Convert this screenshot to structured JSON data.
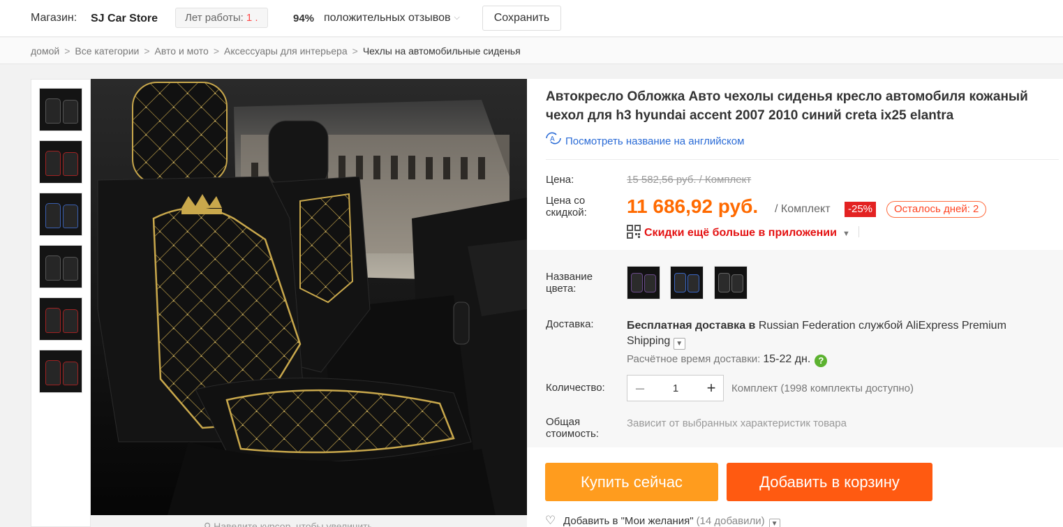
{
  "store": {
    "label": "Магазин:",
    "name": "SJ Car Store",
    "years_label": "Лет работы:",
    "years_value": "1 .",
    "feedback_percent": "94%",
    "feedback_text": "положительных отзывов",
    "save_label": "Сохранить"
  },
  "breadcrumb": {
    "items": [
      "домой",
      "Все категории",
      "Авто и мото",
      "Аксессуары для интерьера"
    ],
    "current": "Чехлы на автомобильные сиденья",
    "separator": ">"
  },
  "gallery": {
    "thumb_count": 6,
    "zoom_hint": "Наведите курсор, чтобы увеличить"
  },
  "product": {
    "title": "Автокресло Обложка Авто чехолы сиденья кресло автомобиля кожаный чехол для h3 hyundai accent 2007 2010 синий creta ix25 elantra",
    "translate_link": "Посмотреть название на английском",
    "price_label": "Цена:",
    "old_price": "15 582,56 руб. / Комплект",
    "discount_price_label": "Цена со скидкой:",
    "new_price": "11 686,92 руб.",
    "unit": "/ Комплект",
    "discount_badge": "-25%",
    "days_left": "Осталось дней: 2",
    "app_discount": "Скидки ещё больше в приложении",
    "color_label": "Название цвета:",
    "shipping_label": "Доставка:",
    "shipping_bold": "Бесплатная доставка в",
    "shipping_rest": "Russian Federation службой AliExpress Premium Shipping",
    "eta_label": "Расчётное время доставки:",
    "eta_value": "15-22 дн.",
    "qty_label": "Количество:",
    "qty_value": "1",
    "qty_minus": "–",
    "qty_plus": "+",
    "availability": "Комплект (1998 комплекты доступно)",
    "total_label": "Общая стоимость:",
    "total_value": "Зависит от выбранных характеристик товара",
    "buy_label": "Купить сейчас",
    "cart_label": "Добавить в корзину",
    "wishlist_label": "Добавить в \"Мои желания\"",
    "wishlist_count": "(14 добавили)"
  },
  "colors": {
    "accent_orange": "#ff6a00",
    "buy_button": "#ff9c1e",
    "cart_button": "#ff5a11",
    "discount_red": "#e32222",
    "link_blue": "#2a6bd6",
    "seat_gold": "#c9a84c"
  },
  "icons": {
    "translate": "translate-icon",
    "qr": "qr-code-icon",
    "help": "help-icon",
    "heart": "heart-icon",
    "chevron": "chevron-down-icon"
  }
}
